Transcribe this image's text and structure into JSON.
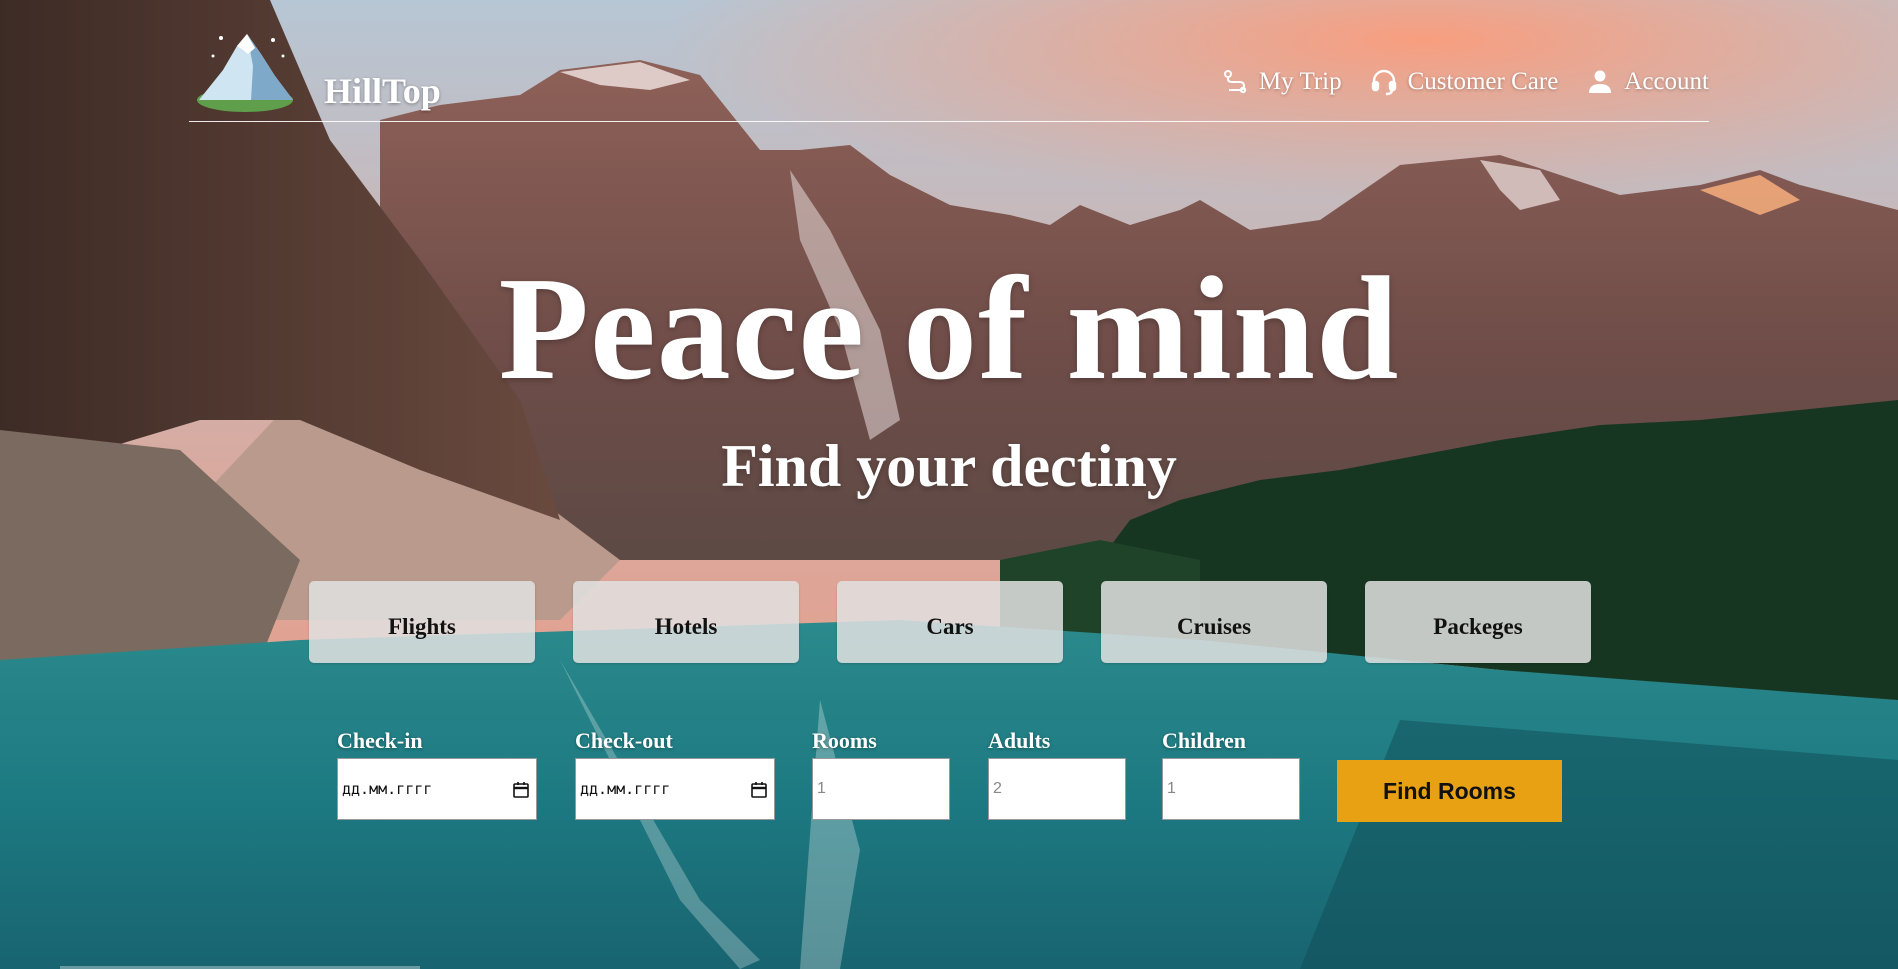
{
  "brand": {
    "name": "HillTop",
    "logo_icon": "mountain-logo-icon"
  },
  "nav": [
    {
      "label": "My Trip",
      "icon": "route-icon"
    },
    {
      "label": "Customer Care",
      "icon": "headset-icon"
    },
    {
      "label": "Account",
      "icon": "user-icon"
    }
  ],
  "hero": {
    "title": "Peace of mind",
    "subtitle": "Find your dectiny"
  },
  "tabs": [
    "Flights",
    "Hotels",
    "Cars",
    "Cruises",
    "Packeges"
  ],
  "search": {
    "checkin": {
      "label": "Check-in",
      "placeholder": "дд.мм.гггг",
      "icon": "calendar-icon"
    },
    "checkout": {
      "label": "Check-out",
      "placeholder": "дд.мм.гггг",
      "icon": "calendar-icon"
    },
    "rooms": {
      "label": "Rooms",
      "placeholder": "1"
    },
    "adults": {
      "label": "Adults",
      "placeholder": "2"
    },
    "children": {
      "label": "Children",
      "placeholder": "1"
    },
    "submit_label": "Find Rooms"
  },
  "colors": {
    "accent": "#e8a112",
    "text": "#ffffff",
    "tab_bg": "#e1e1e1"
  }
}
